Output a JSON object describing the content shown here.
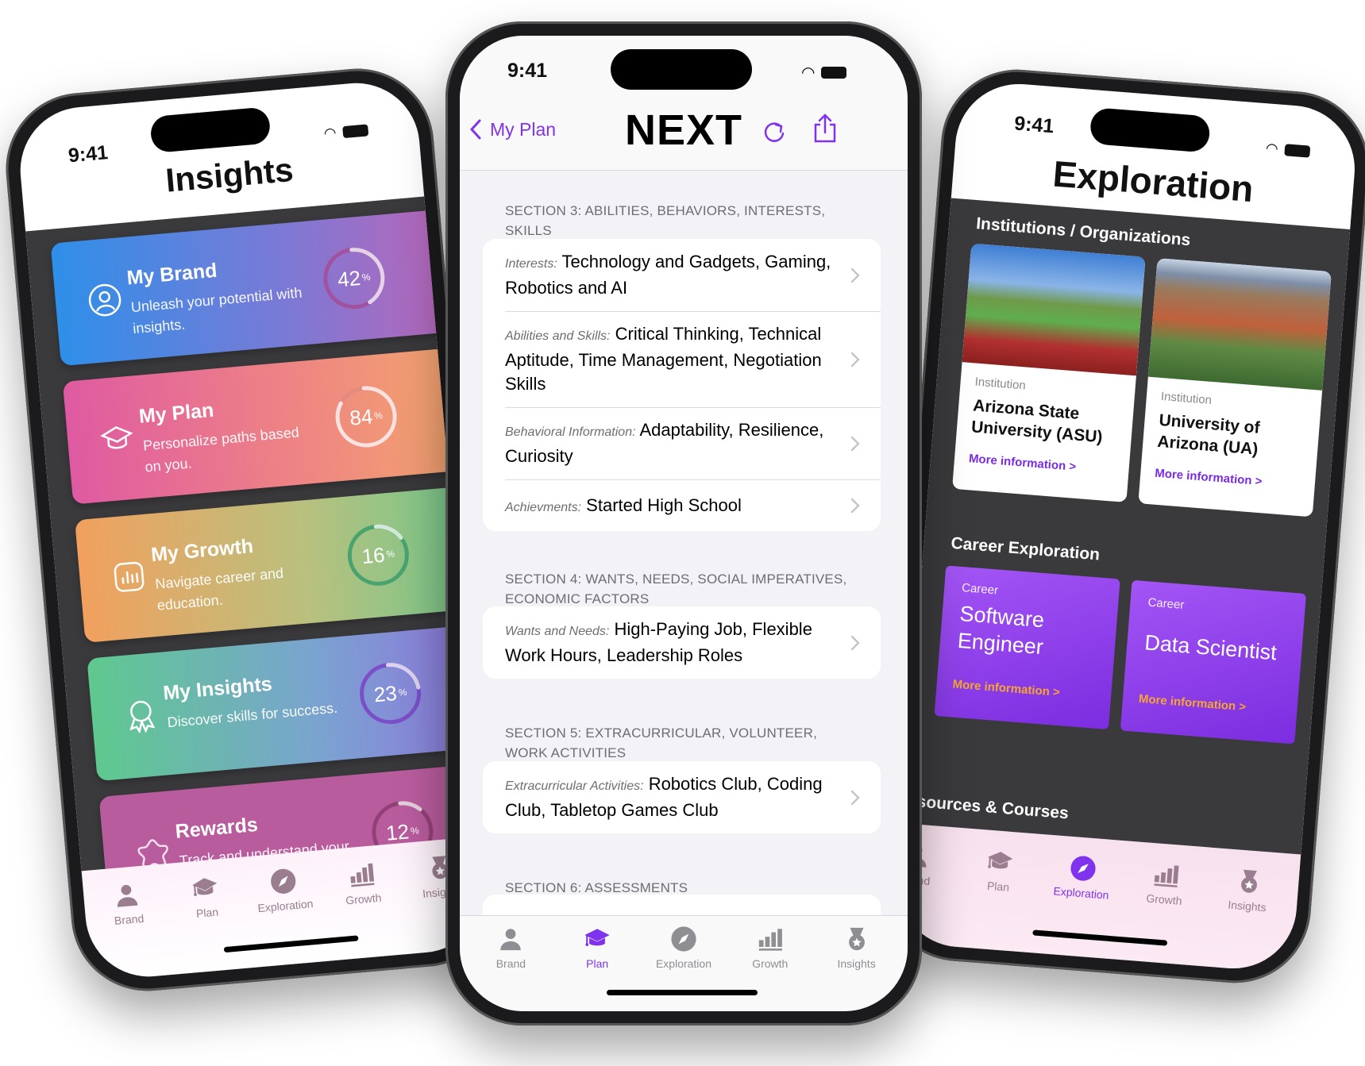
{
  "status_time": "9:41",
  "colors": {
    "accent": "#8033ec",
    "tab_inactive": "#8e8e93",
    "tab_inactive_mauve": "#9a7d8e",
    "career_link": "#f7a531"
  },
  "insights_screen": {
    "title": "Insights",
    "cards": [
      {
        "title": "My Brand",
        "subtitle": "Unleash your potential with insights.",
        "percent": 42,
        "icon": "person-circle-icon"
      },
      {
        "title": "My Plan",
        "subtitle": "Personalize paths based on you.",
        "percent": 84,
        "icon": "graduation-cap-icon"
      },
      {
        "title": "My Growth",
        "subtitle": "Navigate career and education.",
        "percent": 16,
        "icon": "chart-icon"
      },
      {
        "title": "My Insights",
        "subtitle": "Discover skills for success.",
        "percent": 23,
        "icon": "award-icon"
      },
      {
        "title": "Rewards",
        "subtitle": "Track and understand your progress.",
        "percent": 12,
        "icon": "star-icon"
      }
    ],
    "percent_sign": "%",
    "tabs": [
      "Brand",
      "Plan",
      "Exploration",
      "Growth",
      "Insights"
    ],
    "active_tab": null
  },
  "plan_screen": {
    "back_label": "My Plan",
    "title": "NEXT",
    "sections": [
      {
        "header": "Section 3: Abilities, Behaviors, Interests, Skills",
        "rows": [
          {
            "label": "Interests:",
            "value": "Technology and Gadgets, Gaming, Robotics and AI"
          },
          {
            "label": "Abilities and Skills:",
            "value": "Critical Thinking, Technical Aptitude, Time Management, Negotiation Skills"
          },
          {
            "label": "Behavioral Information:",
            "value": "Adaptability, Resilience, Curiosity"
          },
          {
            "label": "Achievments:",
            "value": "Started High School"
          }
        ]
      },
      {
        "header": "Section 4: Wants, Needs, Social Imperatives, Economic Factors",
        "rows": [
          {
            "label": "Wants and Needs:",
            "value": "High-Paying Job, Flexible Work Hours, Leadership Roles"
          }
        ]
      },
      {
        "header": "Section 5: Extracurricular, Volunteer, Work Activities",
        "rows": [
          {
            "label": "Extracurricular Activities:",
            "value": "Robotics Club, Coding Club, Tabletop Games Club"
          }
        ]
      },
      {
        "header": "Section 6: Assessments",
        "rows": []
      }
    ],
    "tabs": [
      "Brand",
      "Plan",
      "Exploration",
      "Growth",
      "Insights"
    ],
    "active_tab": "Plan"
  },
  "exploration_screen": {
    "title": "Exploration",
    "institutions_header": "Institutions / Organizations",
    "institutions": [
      {
        "kind": "Institution",
        "name": "Arizona State University (ASU)",
        "link": "More information >"
      },
      {
        "kind": "Institution",
        "name": "University of Arizona (UA)",
        "link": "More information >"
      }
    ],
    "career_header": "Career Exploration",
    "careers": [
      {
        "kind": "Career",
        "name": "Software Engineer",
        "link": "More information >"
      },
      {
        "kind": "Career",
        "name": "Data Scientist",
        "link": "More information >"
      }
    ],
    "resources_header": "Resources & Courses",
    "tabs": [
      "Brand",
      "Plan",
      "Exploration",
      "Growth",
      "Insights"
    ],
    "active_tab": "Exploration"
  }
}
